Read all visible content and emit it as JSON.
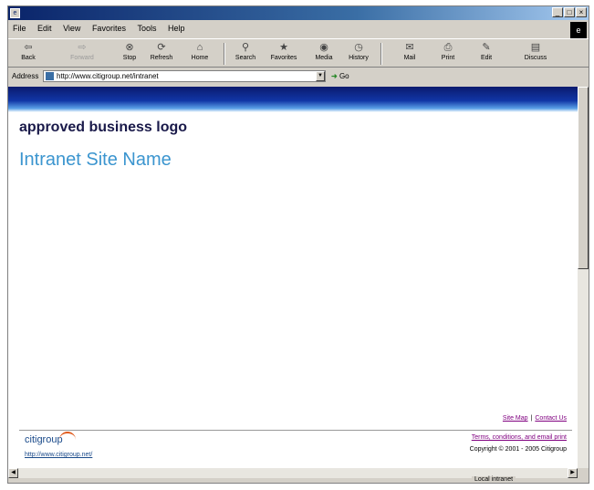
{
  "menu": [
    "File",
    "Edit",
    "View",
    "Favorites",
    "Tools",
    "Help"
  ],
  "window_controls": {
    "minimize": "_",
    "maximize": "□",
    "close": "×"
  },
  "toolbar": {
    "back": "Back",
    "forward": "Forward",
    "stop": "Stop",
    "refresh": "Refresh",
    "home": "Home",
    "search": "Search",
    "favorites": "Favorites",
    "media": "Media",
    "history": "History",
    "mail": "Mail",
    "print": "Print",
    "edit": "Edit",
    "discuss": "Discuss"
  },
  "address": {
    "label": "Address",
    "url": "http://www.citigroup.net/intranet",
    "go_label": "Go"
  },
  "page": {
    "logo_text": "approved business logo",
    "site_name": "Intranet Site Name",
    "footer": {
      "site_map": "Site Map",
      "separator": "|",
      "contact_us": "Contact Us",
      "brand": "citigroup",
      "brand_url": "http://www.citigroup.net/",
      "terms": "Terms, conditions, and email print",
      "copyright": "Copyright © 2001 - 2005 Citigroup"
    }
  },
  "status": {
    "zone": "Local intranet"
  },
  "icons": [
    "ie-logo-icon",
    "back-icon",
    "forward-icon",
    "stop-icon",
    "refresh-icon",
    "home-icon",
    "search-icon",
    "favorites-icon",
    "media-icon",
    "history-icon",
    "mail-icon",
    "print-icon",
    "edit-icon",
    "discuss-icon",
    "page-icon"
  ]
}
